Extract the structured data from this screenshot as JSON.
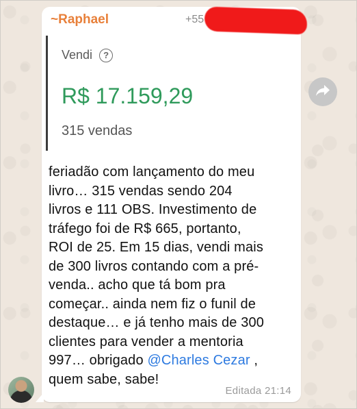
{
  "chat": {
    "sender_name": "~Raphael",
    "sender_phone": "+55",
    "quoted_card": {
      "label": "Vendi",
      "help_icon": "help-circle-icon",
      "amount": "R$ 17.159,29",
      "sales_count": "315 vendas"
    },
    "message_lines": [
      "feriadão com lançamento do meu",
      "livro… 315 vendas sendo 204",
      "livros e 111 OBS. Investimento de",
      "tráfego foi de R$ 665, portanto,",
      "ROI de 25. Em 15 dias, vendi mais",
      "de 300 livros contando com a pré-",
      "venda.. acho que tá bom pra",
      "começar.. ainda nem fiz o funil de",
      "destaque… e já tenho mais de 300",
      "clientes para vender a mentoria"
    ],
    "message_mention_prefix": "997… obrigado ",
    "message_mention": "@Charles Cezar",
    "message_mention_suffix": " ,",
    "message_last_line": "quem sabe, sabe!",
    "edited_label": "Editada",
    "time": "21:14"
  },
  "colors": {
    "sender": "#e8803a",
    "amount": "#2f9a5b",
    "mention": "#2d7ae0",
    "redaction": "#f01a1a"
  },
  "icons": {
    "forward": "forward-arrow-icon",
    "avatar": "avatar"
  }
}
